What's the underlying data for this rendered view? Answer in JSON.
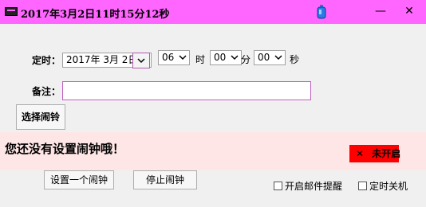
{
  "window": {
    "title": "2017年3月2日11时15分12秒",
    "minimize_glyph": "—",
    "close_glyph": "✕"
  },
  "form": {
    "time_label": "定时：",
    "date_value": "2017年  3月  2日",
    "hour_value": "06",
    "hour_unit": "时",
    "minute_value": "00",
    "minute_unit": "分",
    "second_value": "00",
    "second_unit": "秒",
    "note_label": "备注：",
    "note_value": "",
    "choose_ringtone_button": "选择闹铃"
  },
  "status": {
    "message": "您还没有设置闹钟哦！",
    "badge_glyph": "✕",
    "badge_text": "未开启",
    "badge_color": "#ff0000"
  },
  "actions": {
    "set_alarm_button": "设置一个闹钟",
    "stop_alarm_button": "停止闹钟",
    "email_reminder_label": "开启邮件提醒",
    "email_reminder_checked": false,
    "scheduled_shutdown_label": "定时关机",
    "scheduled_shutdown_checked": false
  },
  "colors": {
    "titlebar": "#ff66ff",
    "alert_background": "#ffe6e6"
  },
  "icons": {
    "app": "app-icon",
    "pin": "bottle-icon",
    "dropdown": "chevron-down-icon"
  }
}
